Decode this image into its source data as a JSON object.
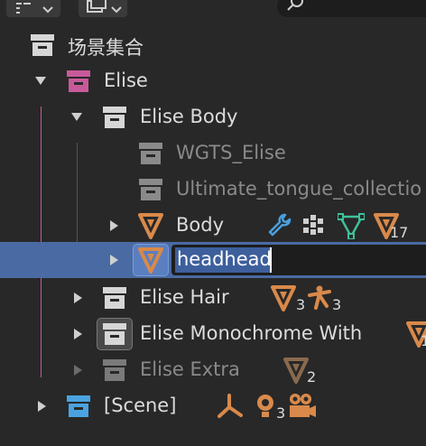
{
  "header": {
    "filter_icon": "filter-icon",
    "display_mode_icon": "display-mode-icon",
    "search_icon": "search-icon"
  },
  "outliner": {
    "root": {
      "label": "场景集合"
    },
    "rows": [
      {
        "id": "elise",
        "label": "Elise",
        "color": "#c85a9a"
      },
      {
        "id": "elise-body",
        "label": "Elise Body"
      },
      {
        "id": "wgts-elise",
        "label": "WGTS_Elise",
        "dim": true
      },
      {
        "id": "ultimate-tongue",
        "label": "Ultimate_tongue_collectio",
        "dim": true
      },
      {
        "id": "body",
        "label": "Body",
        "counts": {
          "mesh": "17"
        }
      },
      {
        "id": "headhead",
        "label": "headhead",
        "editing": true
      },
      {
        "id": "elise-hair",
        "label": "Elise Hair",
        "counts": {
          "mesh": "3",
          "armature": "3"
        }
      },
      {
        "id": "elise-monochrome",
        "label": "Elise Monochrome With",
        "counts": {
          "mesh": "1"
        }
      },
      {
        "id": "elise-extra",
        "label": "Elise Extra",
        "dim": true,
        "counts": {
          "mesh": "2"
        }
      },
      {
        "id": "scene",
        "label": "[Scene]",
        "counts": {
          "light": "3"
        }
      }
    ]
  },
  "colors": {
    "background": "#282828",
    "selection": "#4a6aa3",
    "object_orange": "#d9894a",
    "mesh_green": "#3ec19b",
    "scene_blue": "#4aa3e0",
    "collection_pink": "#c85a9a"
  }
}
